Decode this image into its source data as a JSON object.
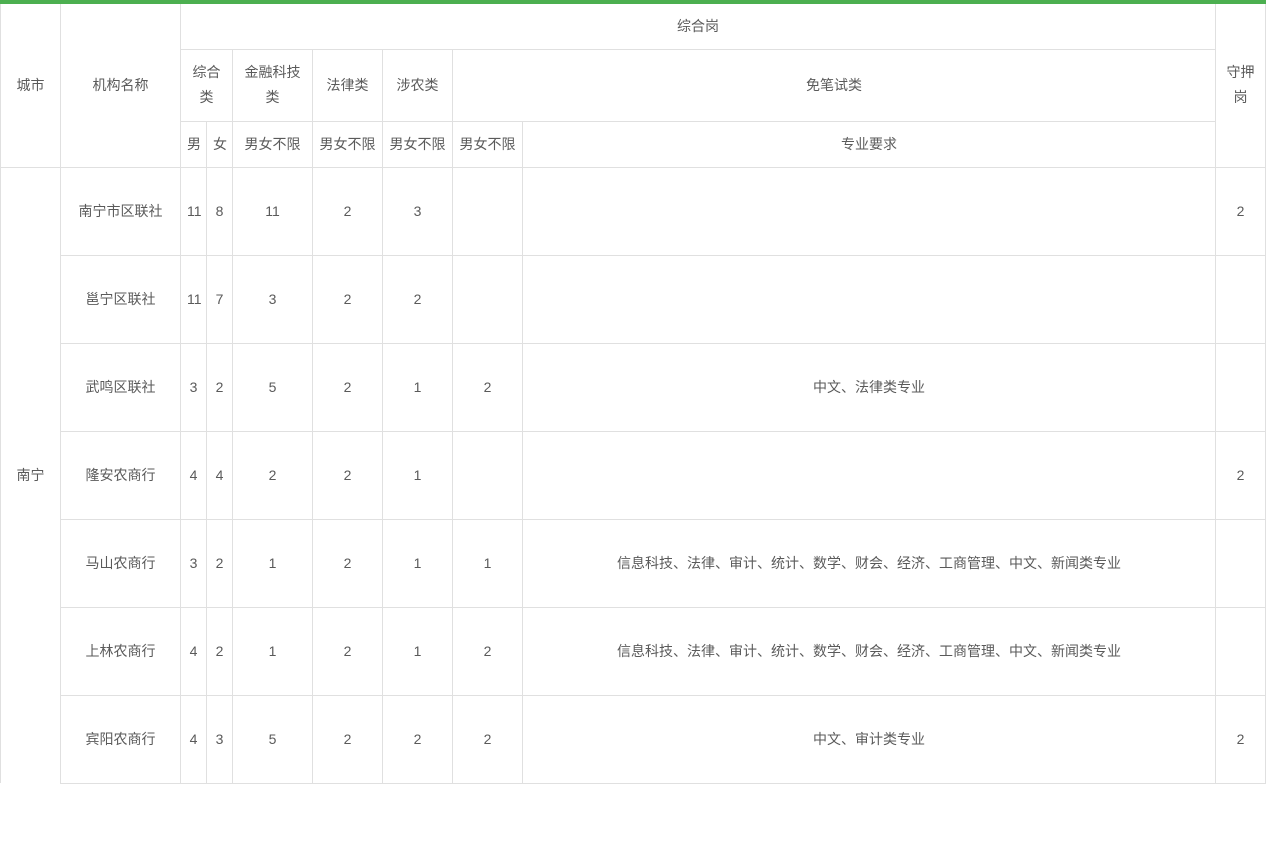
{
  "headers": {
    "city": "城市",
    "org": "机构名称",
    "comprehensive_post": "综合岗",
    "guard_post": "守押岗",
    "comprehensive_cat": "综合类",
    "fintech_cat": "金融科技类",
    "law_cat": "法律类",
    "agri_cat": "涉农类",
    "exempt_cat": "免笔试类",
    "male": "男",
    "female": "女",
    "unlimited": "男女不限",
    "requirement": "专业要求"
  },
  "city_group": "南宁",
  "rows": [
    {
      "org": "南宁市区联社",
      "male": "11",
      "female": "8",
      "fintech": "11",
      "law": "2",
      "agri": "3",
      "exempt_num": "",
      "requirement": "",
      "guard": "2"
    },
    {
      "org": "邕宁区联社",
      "male": "11",
      "female": "7",
      "fintech": "3",
      "law": "2",
      "agri": "2",
      "exempt_num": "",
      "requirement": "",
      "guard": ""
    },
    {
      "org": "武鸣区联社",
      "male": "3",
      "female": "2",
      "fintech": "5",
      "law": "2",
      "agri": "1",
      "exempt_num": "2",
      "requirement": "中文、法律类专业",
      "guard": ""
    },
    {
      "org": "隆安农商行",
      "male": "4",
      "female": "4",
      "fintech": "2",
      "law": "2",
      "agri": "1",
      "exempt_num": "",
      "requirement": "",
      "guard": "2"
    },
    {
      "org": "马山农商行",
      "male": "3",
      "female": "2",
      "fintech": "1",
      "law": "2",
      "agri": "1",
      "exempt_num": "1",
      "requirement": "信息科技、法律、审计、统计、数学、财会、经济、工商管理、中文、新闻类专业",
      "guard": ""
    },
    {
      "org": "上林农商行",
      "male": "4",
      "female": "2",
      "fintech": "1",
      "law": "2",
      "agri": "1",
      "exempt_num": "2",
      "requirement": "信息科技、法律、审计、统计、数学、财会、经济、工商管理、中文、新闻类专业",
      "guard": ""
    },
    {
      "org": "宾阳农商行",
      "male": "4",
      "female": "3",
      "fintech": "5",
      "law": "2",
      "agri": "2",
      "exempt_num": "2",
      "requirement": "中文、审计类专业",
      "guard": "2"
    }
  ]
}
